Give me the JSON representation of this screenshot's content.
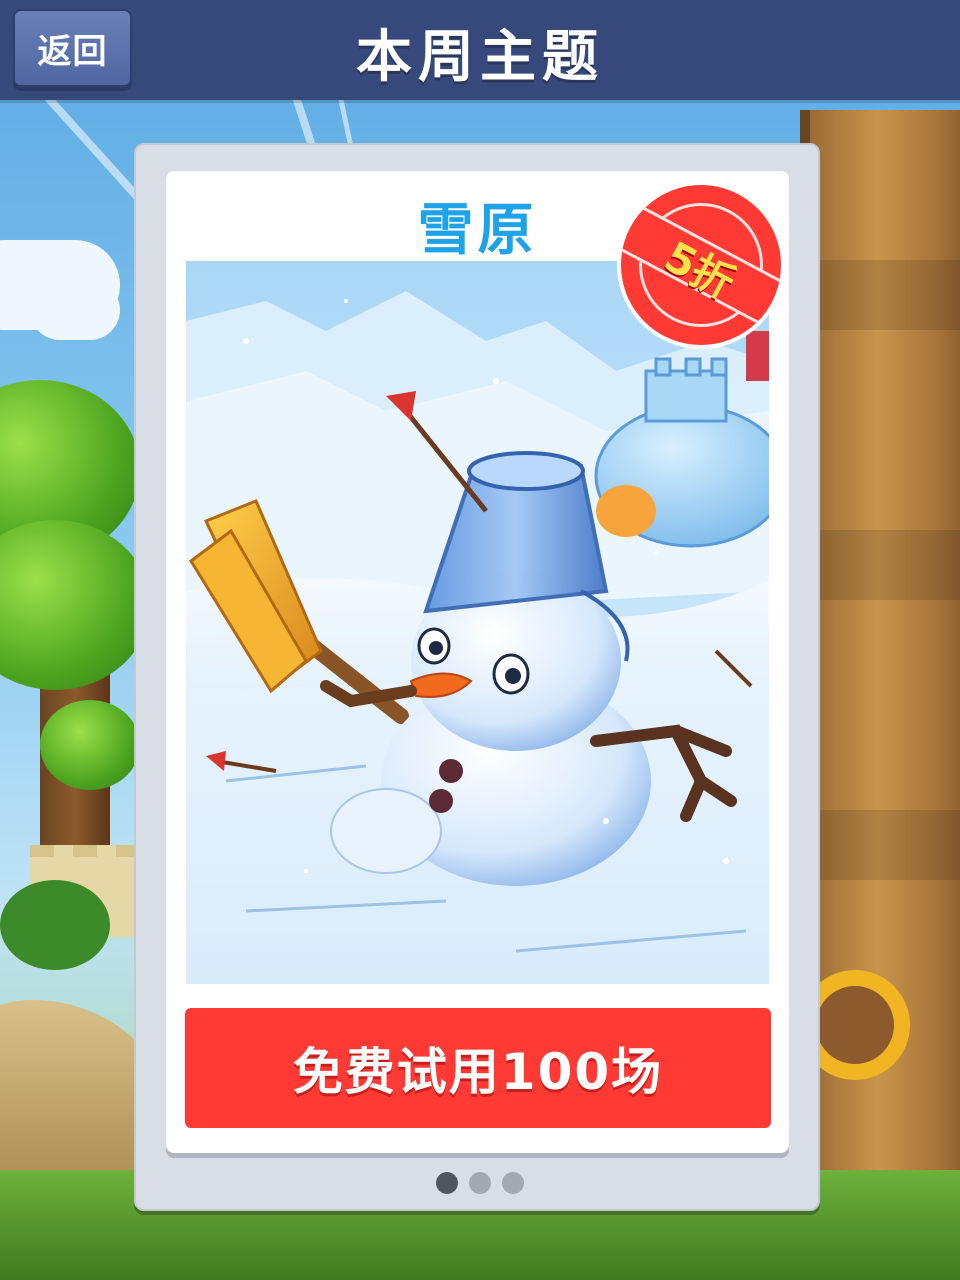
{
  "header": {
    "back_label": "返回",
    "title": "本周主题"
  },
  "theme": {
    "name": "雪原",
    "discount_badge": "5折",
    "action_label": "免费试用100场"
  },
  "pagination": {
    "count": 3,
    "active_index": 0
  },
  "colors": {
    "header_bg": "#36497a",
    "theme_title": "#1fa3e8",
    "action_button": "#ff3a34",
    "badge_text": "#ffe14d"
  }
}
